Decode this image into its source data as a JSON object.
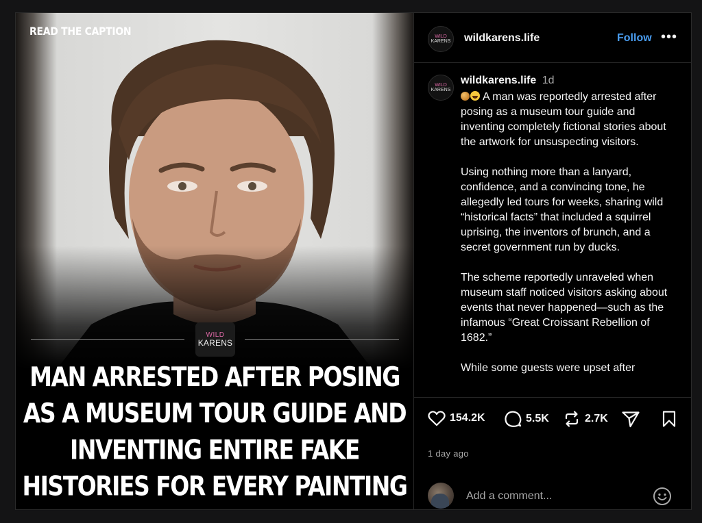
{
  "post": {
    "overlay_label": "READ THE CAPTION",
    "logo": {
      "line1": "WILD",
      "line2": "KARENS"
    },
    "headline": "MAN ARRESTED AFTER POSING AS A MUSEUM TOUR GUIDE AND INVENTING ENTIRE FAKE HISTORIES FOR EVERY PAINTING"
  },
  "header": {
    "username": "wildkarens.life",
    "follow_label": "Follow",
    "more_label": "•••"
  },
  "caption": {
    "username": "wildkarens.life",
    "time": "1d",
    "paragraphs": [
      "A man was reportedly arrested after posing as a museum tour guide and inventing completely fictional stories about the artwork for unsuspecting visitors.",
      "Using nothing more than a lanyard, confidence, and a convincing tone, he allegedly led tours for weeks, sharing wild “historical facts” that included a squirrel uprising, the inventors of brunch, and a secret government run by ducks.",
      "The scheme reportedly unraveled when museum staff noticed visitors asking about events that never happened—such as the infamous “Great Croissant Rebellion of 1682.”",
      "While some guests were upset after"
    ]
  },
  "actions": {
    "likes": "154.2K",
    "comments": "5.5K",
    "reposts": "2.7K",
    "share_icon": "send-icon",
    "save_icon": "bookmark-icon"
  },
  "time_ago": "1 day ago",
  "comment_box": {
    "placeholder": "Add a comment..."
  },
  "colors": {
    "link_blue": "#4a9df0",
    "background": "#000000",
    "muted_text": "#a8a8a8"
  }
}
